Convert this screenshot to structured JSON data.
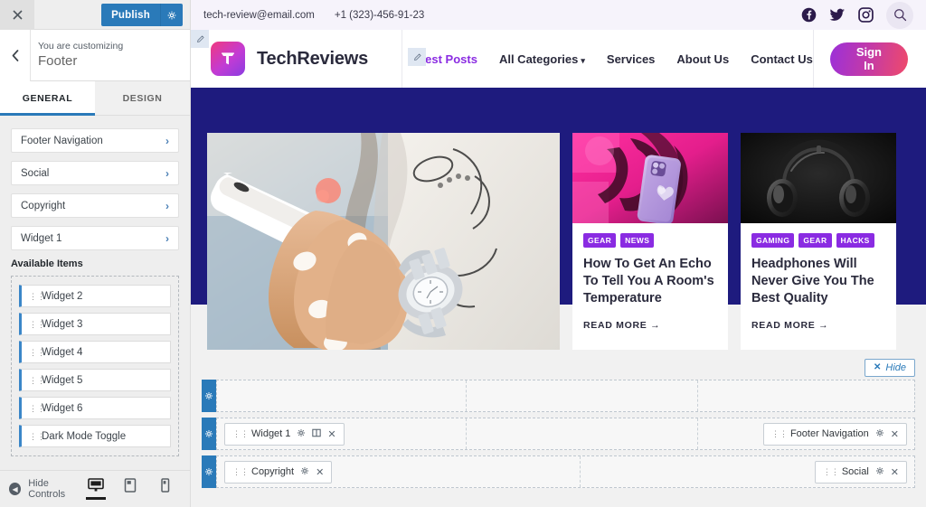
{
  "customizer": {
    "close_label": "✕",
    "publish_label": "Publish",
    "publish_gear_icon": "gear-icon",
    "back_label": "‹",
    "eyebrow": "You are customizing",
    "title": "Footer",
    "tabs": [
      {
        "label": "GENERAL",
        "active": true
      },
      {
        "label": "DESIGN",
        "active": false
      }
    ],
    "panel_items": [
      {
        "label": "Footer Navigation",
        "chevron": "›"
      },
      {
        "label": "Social",
        "chevron": "›"
      },
      {
        "label": "Copyright",
        "chevron": "›"
      },
      {
        "label": "Widget 1",
        "chevron": "›"
      }
    ],
    "available_items_label": "Available Items",
    "available_items": [
      {
        "label": "Widget 2"
      },
      {
        "label": "Widget 3"
      },
      {
        "label": "Widget 4"
      },
      {
        "label": "Widget 5"
      },
      {
        "label": "Widget 6"
      },
      {
        "label": "Dark Mode Toggle"
      }
    ],
    "footer": {
      "hide_controls_label": "Hide Controls",
      "devices": [
        {
          "name": "desktop-preview-icon",
          "active": true
        },
        {
          "name": "tablet-preview-icon",
          "active": false
        },
        {
          "name": "mobile-preview-icon",
          "active": false
        }
      ]
    }
  },
  "site": {
    "topbar": {
      "email": "tech-review@email.com",
      "phone": "+1 (323)-456-91-23",
      "socials": [
        "facebook-icon",
        "twitter-icon",
        "instagram-icon"
      ],
      "search_icon": "search-icon"
    },
    "brand": {
      "name": "TechReviews",
      "logo_icon": "techreviews-logo-icon"
    },
    "nav": [
      {
        "label": "Best Posts",
        "active": true,
        "caret": false
      },
      {
        "label": "All Categories",
        "active": false,
        "caret": true
      },
      {
        "label": "Services",
        "active": false,
        "caret": false
      },
      {
        "label": "About Us",
        "active": false,
        "caret": false
      },
      {
        "label": "Contact Us",
        "active": false,
        "caret": false
      }
    ],
    "signin_label": "Sign In",
    "edit_pin_icon": "pencil-edit-icon",
    "hero": {
      "background_color": "#1e1b7e",
      "featured_image_alt": "hands-holding-white-smartphone"
    },
    "cards": [
      {
        "image_alt": "purple-iphone-neon-pink-monstera-leaf",
        "tags": [
          "GEAR",
          "NEWS"
        ],
        "title": "How To Get An Echo To Tell You A Room's Temperature",
        "read_more": "READ MORE",
        "arrow": "→"
      },
      {
        "image_alt": "black-over-ear-headphones-dark-background",
        "tags": [
          "GAMING",
          "GEAR",
          "HACKS"
        ],
        "title": "Headphones Will Never Give You The Best Quality",
        "read_more": "READ MORE",
        "arrow": "→"
      }
    ]
  },
  "footer_builder": {
    "hide_button": {
      "x": "✕",
      "label": "Hide"
    },
    "rows": [
      {
        "handle_icon": "gear-icon",
        "columns": [
          {
            "widgets": []
          },
          {
            "widgets": []
          },
          {
            "widgets": []
          }
        ]
      },
      {
        "handle_icon": "gear-icon",
        "columns": [
          {
            "widgets": [
              {
                "label": "Widget 1",
                "icons": [
                  "gear-icon",
                  "columns-icon",
                  "close-icon"
                ]
              }
            ]
          },
          {
            "widgets": []
          },
          {
            "widgets": [
              {
                "label": "Footer Navigation",
                "icons": [
                  "gear-icon",
                  "close-icon"
                ]
              }
            ],
            "align": "right"
          }
        ]
      },
      {
        "handle_icon": "gear-icon",
        "columns": [
          {
            "widgets": [
              {
                "label": "Copyright",
                "icons": [
                  "gear-icon",
                  "close-icon"
                ]
              }
            ]
          },
          {
            "widgets": [
              {
                "label": "Social",
                "icons": [
                  "gear-icon",
                  "close-icon"
                ]
              }
            ],
            "align": "right"
          }
        ]
      }
    ]
  },
  "colors": {
    "accent_blue": "#2a7ab9",
    "hero_navy": "#1e1b7e",
    "tag_purple": "#8a2be2",
    "brand_pink": "#ef4a6a"
  }
}
